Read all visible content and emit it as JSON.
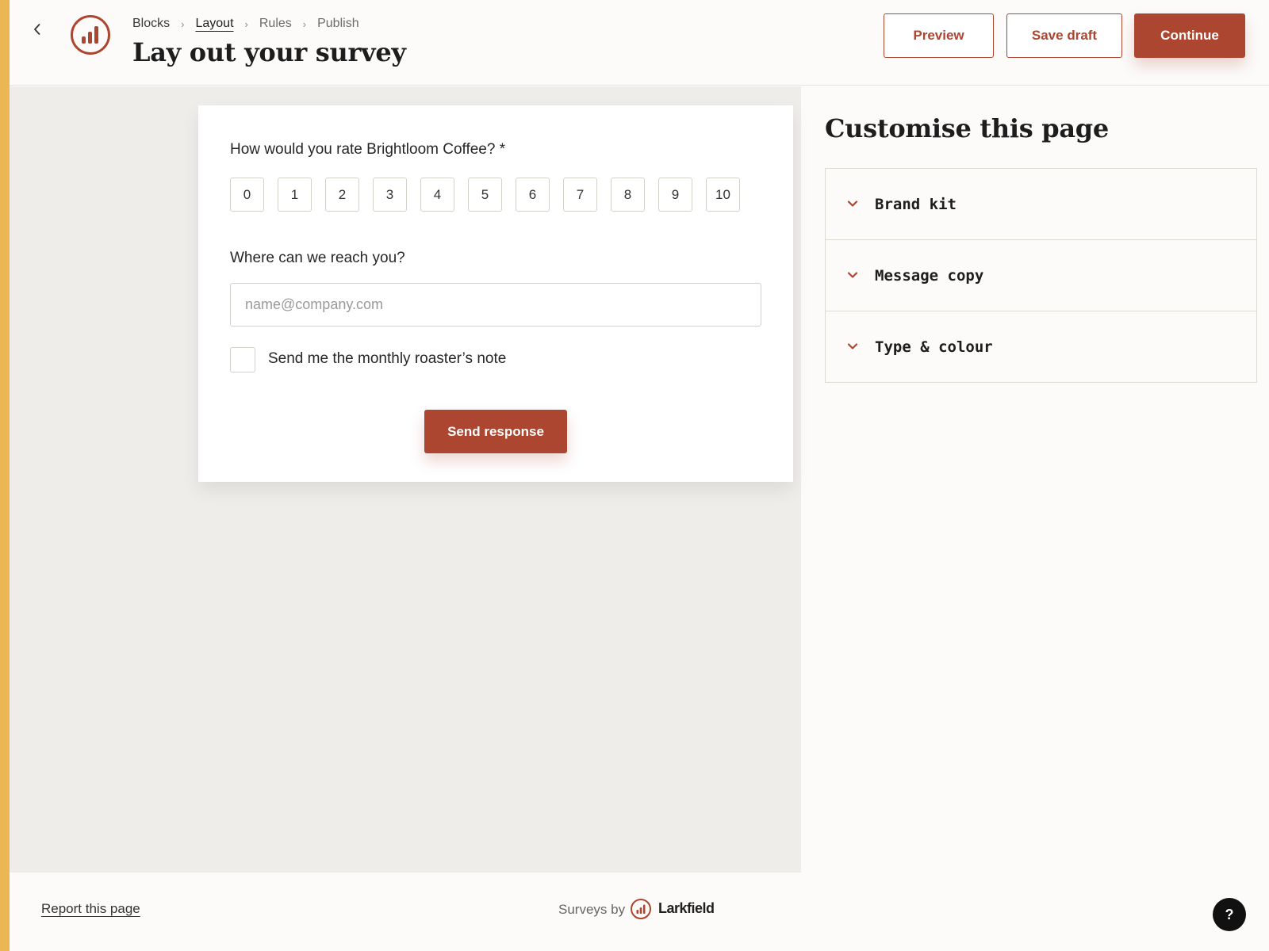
{
  "header": {
    "back_icon": "chevron-left-icon",
    "logo_icon": "bar-chart-circle-icon",
    "breadcrumb": [
      "Blocks",
      "Layout",
      "Rules",
      "Publish"
    ],
    "active_step": "Layout",
    "title": "Lay out your survey",
    "preview_label": "Preview",
    "save_draft_label": "Save draft",
    "continue_label": "Continue"
  },
  "survey": {
    "rating_question": "How would you rate Brightloom Coffee? *",
    "rating_options": [
      "0",
      "1",
      "2",
      "3",
      "4",
      "5",
      "6",
      "7",
      "8",
      "9",
      "10"
    ],
    "contact_question": "Where can we reach you?",
    "email_placeholder": "name@company.com",
    "email_value": "",
    "checkbox_label": "Send me the monthly roaster’s note",
    "checkbox_checked": false,
    "submit_label": "Send response"
  },
  "panel": {
    "title": "Customise this page",
    "sections": [
      "Brand kit",
      "Message copy",
      "Type & colour"
    ],
    "section_icon": "chevron-down-icon"
  },
  "footer": {
    "report_link": "Report this page",
    "surveys_by": "Surveys by",
    "brand": "Larkfield",
    "help_label": "?"
  },
  "colors": {
    "accent": "#ad4630",
    "stripe": "#ecb653",
    "canvas": "#efedea"
  }
}
